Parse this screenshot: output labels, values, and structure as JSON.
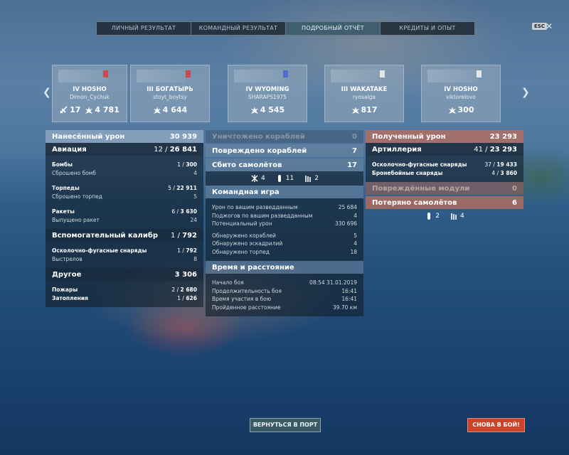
{
  "tabs": [
    {
      "label": "ЛИЧНЫЙ РЕЗУЛЬТАТ",
      "active": false
    },
    {
      "label": "КОМАНДНЫЙ РЕЗУЛЬТАТ",
      "active": false
    },
    {
      "label": "ПОДРОБНЫЙ ОТЧЁТ",
      "active": true
    },
    {
      "label": "КРЕДИТЫ И ОПЫТ",
      "active": false
    }
  ],
  "esc": {
    "label": "ESC"
  },
  "cards": [
    {
      "mini": "IV HOSHO",
      "ship": "IV HOSHO",
      "player": "Dimon_Cychuk",
      "stat1": "17",
      "stat2": "4 781",
      "stat1_icon": "plane-icon",
      "stat2_icon": "damage-burst-icon"
    },
    {
      "mini": "III БОГАТЫРЬ",
      "ship": "III БОГАТЫРЬ",
      "player": "stoyt_boytsy",
      "stat1": "",
      "stat2": "4 644",
      "stat2_icon": "damage-burst-icon"
    },
    {
      "mini": "IV WYOMING",
      "ship": "IV WYOMING",
      "player": "SHARAPS1975",
      "stat1": "",
      "stat2": "4 545",
      "stat2_icon": "damage-burst-icon"
    },
    {
      "mini": "III WAKATAKE",
      "ship": "III WAKATAKE",
      "player": "ryosaiga",
      "stat1": "",
      "stat2": "817",
      "stat2_icon": "damage-burst-icon"
    },
    {
      "mini": "IV HOSHO",
      "ship": "IV HOSHO",
      "player": "viktorelovo",
      "stat1": "",
      "stat2": "300",
      "stat2_icon": "damage-burst-icon"
    }
  ],
  "left": {
    "damage": {
      "label": "Нанесённый урон",
      "value": "30 939"
    },
    "aviation": {
      "label": "Авиация",
      "value_a": "12",
      "value_b": "26 841"
    },
    "bombs": {
      "label": "Бомбы",
      "value_a": "1",
      "value_b": "300"
    },
    "bombs_dropped": {
      "label": "Сброшено бомб",
      "value": "4"
    },
    "torps": {
      "label": "Торпеды",
      "value_a": "5",
      "value_b": "22 911"
    },
    "torps_dropped": {
      "label": "Сброшено торпед",
      "value": "5"
    },
    "rockets": {
      "label": "Ракеты",
      "value_a": "6",
      "value_b": "3 630"
    },
    "rockets_fired": {
      "label": "Выпущено ракет",
      "value": "24"
    },
    "secondary": {
      "label": "Вспомогательный калибр",
      "value_a": "1",
      "value_b": "792"
    },
    "he": {
      "label": "Осколочно-фугасные снаряды",
      "value_a": "1",
      "value_b": "792"
    },
    "shots": {
      "label": "Выстрелов",
      "value": "8"
    },
    "other": {
      "label": "Другое",
      "value": "3 306"
    },
    "fires": {
      "label": "Пожары",
      "value_a": "2",
      "value_b": "2 680"
    },
    "floods": {
      "label": "Затопления",
      "value_a": "1",
      "value_b": "626"
    }
  },
  "middle": {
    "destroyed": {
      "label": "Уничтожено кораблей",
      "value": "0"
    },
    "damaged": {
      "label": "Повреждено кораблей",
      "value": "7"
    },
    "planes_shot": {
      "label": "Сбито самолётов",
      "value": "17"
    },
    "plane_types": [
      {
        "icon": "fighter-plane-icon",
        "value": "4"
      },
      {
        "icon": "bomber-plane-icon",
        "value": "11"
      },
      {
        "icon": "torpedo-bomber-icon",
        "value": "2"
      }
    ],
    "team": {
      "label": "Командная игра"
    },
    "team_rows": [
      {
        "label": "Урон по вашим разведданным",
        "value": "25 684"
      },
      {
        "label": "Поджогов по вашим разведданным",
        "value": "4"
      },
      {
        "label": "Потенциальный урон",
        "value": "330 696"
      },
      {
        "label": "Обнаружено кораблей",
        "value": "5"
      },
      {
        "label": "Обнаружено эскадрилий",
        "value": "4"
      },
      {
        "label": "Обнаружено торпед",
        "value": "18"
      }
    ],
    "time": {
      "label": "Время и расстояние"
    },
    "time_rows": [
      {
        "label": "Начало боя",
        "value": "08:54  31.01.2019"
      },
      {
        "label": "Продолжительность боя",
        "value": "16:41"
      },
      {
        "label": "Время участия в бою",
        "value": "16:41"
      },
      {
        "label": "Пройденное расстояние",
        "value": "39.70 км"
      }
    ]
  },
  "right": {
    "received": {
      "label": "Полученный урон",
      "value": "23 293"
    },
    "artillery": {
      "label": "Артиллерия",
      "value_a": "41",
      "value_b": "23 293"
    },
    "he": {
      "label": "Осколочно-фугасные снаряды",
      "value_a": "37",
      "value_b": "19 433"
    },
    "ap": {
      "label": "Бронебойные снаряды",
      "value_a": "4",
      "value_b": "3 860"
    },
    "modules": {
      "label": "Повреждённые модули",
      "value": "0"
    },
    "planes_lost": {
      "label": "Потеряно самолётов",
      "value": "6"
    },
    "plane_types": [
      {
        "icon": "bomber-plane-icon",
        "value": "2"
      },
      {
        "icon": "torpedo-bomber-icon",
        "value": "4"
      }
    ]
  },
  "buttons": {
    "port": "ВЕРНУТЬСЯ В ПОРТ",
    "battle": "СНОВА В БОЙ!"
  }
}
